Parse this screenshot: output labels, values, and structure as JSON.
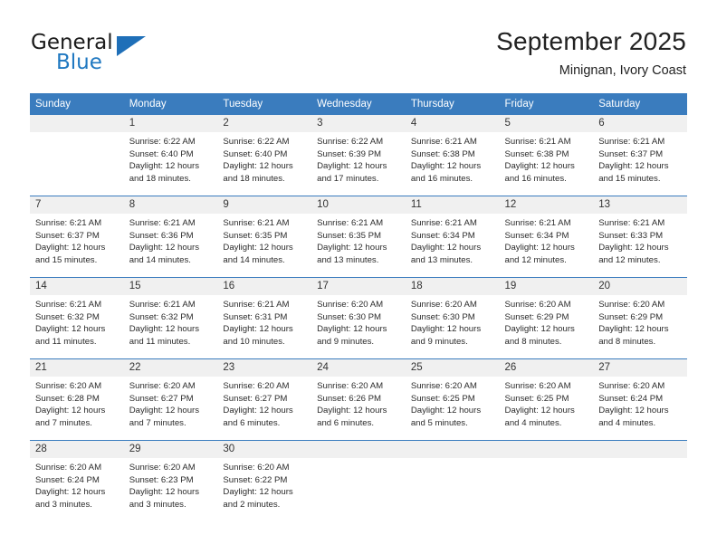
{
  "brand": {
    "line1": "General",
    "line2": "Blue",
    "triangle_color": "#1f6fb8",
    "blue_color": "#1f78c1"
  },
  "header": {
    "month_title": "September 2025",
    "location": "Minignan, Ivory Coast"
  },
  "theme": {
    "header_row_bg": "#3a7cbe",
    "daynum_bg": "#f0f0f0",
    "grid_line": "#3a7cbe"
  },
  "calendar": {
    "weekday_headers": [
      "Sunday",
      "Monday",
      "Tuesday",
      "Wednesday",
      "Thursday",
      "Friday",
      "Saturday"
    ],
    "weeks": [
      [
        {
          "day": "",
          "sunrise": "",
          "sunset": "",
          "daylight_l1": "",
          "daylight_l2": "",
          "empty": true
        },
        {
          "day": "1",
          "sunrise": "Sunrise: 6:22 AM",
          "sunset": "Sunset: 6:40 PM",
          "daylight_l1": "Daylight: 12 hours",
          "daylight_l2": "and 18 minutes."
        },
        {
          "day": "2",
          "sunrise": "Sunrise: 6:22 AM",
          "sunset": "Sunset: 6:40 PM",
          "daylight_l1": "Daylight: 12 hours",
          "daylight_l2": "and 18 minutes."
        },
        {
          "day": "3",
          "sunrise": "Sunrise: 6:22 AM",
          "sunset": "Sunset: 6:39 PM",
          "daylight_l1": "Daylight: 12 hours",
          "daylight_l2": "and 17 minutes."
        },
        {
          "day": "4",
          "sunrise": "Sunrise: 6:21 AM",
          "sunset": "Sunset: 6:38 PM",
          "daylight_l1": "Daylight: 12 hours",
          "daylight_l2": "and 16 minutes."
        },
        {
          "day": "5",
          "sunrise": "Sunrise: 6:21 AM",
          "sunset": "Sunset: 6:38 PM",
          "daylight_l1": "Daylight: 12 hours",
          "daylight_l2": "and 16 minutes."
        },
        {
          "day": "6",
          "sunrise": "Sunrise: 6:21 AM",
          "sunset": "Sunset: 6:37 PM",
          "daylight_l1": "Daylight: 12 hours",
          "daylight_l2": "and 15 minutes."
        }
      ],
      [
        {
          "day": "7",
          "sunrise": "Sunrise: 6:21 AM",
          "sunset": "Sunset: 6:37 PM",
          "daylight_l1": "Daylight: 12 hours",
          "daylight_l2": "and 15 minutes."
        },
        {
          "day": "8",
          "sunrise": "Sunrise: 6:21 AM",
          "sunset": "Sunset: 6:36 PM",
          "daylight_l1": "Daylight: 12 hours",
          "daylight_l2": "and 14 minutes."
        },
        {
          "day": "9",
          "sunrise": "Sunrise: 6:21 AM",
          "sunset": "Sunset: 6:35 PM",
          "daylight_l1": "Daylight: 12 hours",
          "daylight_l2": "and 14 minutes."
        },
        {
          "day": "10",
          "sunrise": "Sunrise: 6:21 AM",
          "sunset": "Sunset: 6:35 PM",
          "daylight_l1": "Daylight: 12 hours",
          "daylight_l2": "and 13 minutes."
        },
        {
          "day": "11",
          "sunrise": "Sunrise: 6:21 AM",
          "sunset": "Sunset: 6:34 PM",
          "daylight_l1": "Daylight: 12 hours",
          "daylight_l2": "and 13 minutes."
        },
        {
          "day": "12",
          "sunrise": "Sunrise: 6:21 AM",
          "sunset": "Sunset: 6:34 PM",
          "daylight_l1": "Daylight: 12 hours",
          "daylight_l2": "and 12 minutes."
        },
        {
          "day": "13",
          "sunrise": "Sunrise: 6:21 AM",
          "sunset": "Sunset: 6:33 PM",
          "daylight_l1": "Daylight: 12 hours",
          "daylight_l2": "and 12 minutes."
        }
      ],
      [
        {
          "day": "14",
          "sunrise": "Sunrise: 6:21 AM",
          "sunset": "Sunset: 6:32 PM",
          "daylight_l1": "Daylight: 12 hours",
          "daylight_l2": "and 11 minutes."
        },
        {
          "day": "15",
          "sunrise": "Sunrise: 6:21 AM",
          "sunset": "Sunset: 6:32 PM",
          "daylight_l1": "Daylight: 12 hours",
          "daylight_l2": "and 11 minutes."
        },
        {
          "day": "16",
          "sunrise": "Sunrise: 6:21 AM",
          "sunset": "Sunset: 6:31 PM",
          "daylight_l1": "Daylight: 12 hours",
          "daylight_l2": "and 10 minutes."
        },
        {
          "day": "17",
          "sunrise": "Sunrise: 6:20 AM",
          "sunset": "Sunset: 6:30 PM",
          "daylight_l1": "Daylight: 12 hours",
          "daylight_l2": "and 9 minutes."
        },
        {
          "day": "18",
          "sunrise": "Sunrise: 6:20 AM",
          "sunset": "Sunset: 6:30 PM",
          "daylight_l1": "Daylight: 12 hours",
          "daylight_l2": "and 9 minutes."
        },
        {
          "day": "19",
          "sunrise": "Sunrise: 6:20 AM",
          "sunset": "Sunset: 6:29 PM",
          "daylight_l1": "Daylight: 12 hours",
          "daylight_l2": "and 8 minutes."
        },
        {
          "day": "20",
          "sunrise": "Sunrise: 6:20 AM",
          "sunset": "Sunset: 6:29 PM",
          "daylight_l1": "Daylight: 12 hours",
          "daylight_l2": "and 8 minutes."
        }
      ],
      [
        {
          "day": "21",
          "sunrise": "Sunrise: 6:20 AM",
          "sunset": "Sunset: 6:28 PM",
          "daylight_l1": "Daylight: 12 hours",
          "daylight_l2": "and 7 minutes."
        },
        {
          "day": "22",
          "sunrise": "Sunrise: 6:20 AM",
          "sunset": "Sunset: 6:27 PM",
          "daylight_l1": "Daylight: 12 hours",
          "daylight_l2": "and 7 minutes."
        },
        {
          "day": "23",
          "sunrise": "Sunrise: 6:20 AM",
          "sunset": "Sunset: 6:27 PM",
          "daylight_l1": "Daylight: 12 hours",
          "daylight_l2": "and 6 minutes."
        },
        {
          "day": "24",
          "sunrise": "Sunrise: 6:20 AM",
          "sunset": "Sunset: 6:26 PM",
          "daylight_l1": "Daylight: 12 hours",
          "daylight_l2": "and 6 minutes."
        },
        {
          "day": "25",
          "sunrise": "Sunrise: 6:20 AM",
          "sunset": "Sunset: 6:25 PM",
          "daylight_l1": "Daylight: 12 hours",
          "daylight_l2": "and 5 minutes."
        },
        {
          "day": "26",
          "sunrise": "Sunrise: 6:20 AM",
          "sunset": "Sunset: 6:25 PM",
          "daylight_l1": "Daylight: 12 hours",
          "daylight_l2": "and 4 minutes."
        },
        {
          "day": "27",
          "sunrise": "Sunrise: 6:20 AM",
          "sunset": "Sunset: 6:24 PM",
          "daylight_l1": "Daylight: 12 hours",
          "daylight_l2": "and 4 minutes."
        }
      ],
      [
        {
          "day": "28",
          "sunrise": "Sunrise: 6:20 AM",
          "sunset": "Sunset: 6:24 PM",
          "daylight_l1": "Daylight: 12 hours",
          "daylight_l2": "and 3 minutes."
        },
        {
          "day": "29",
          "sunrise": "Sunrise: 6:20 AM",
          "sunset": "Sunset: 6:23 PM",
          "daylight_l1": "Daylight: 12 hours",
          "daylight_l2": "and 3 minutes."
        },
        {
          "day": "30",
          "sunrise": "Sunrise: 6:20 AM",
          "sunset": "Sunset: 6:22 PM",
          "daylight_l1": "Daylight: 12 hours",
          "daylight_l2": "and 2 minutes."
        },
        {
          "day": "",
          "sunrise": "",
          "sunset": "",
          "daylight_l1": "",
          "daylight_l2": "",
          "empty": true
        },
        {
          "day": "",
          "sunrise": "",
          "sunset": "",
          "daylight_l1": "",
          "daylight_l2": "",
          "empty": true
        },
        {
          "day": "",
          "sunrise": "",
          "sunset": "",
          "daylight_l1": "",
          "daylight_l2": "",
          "empty": true
        },
        {
          "day": "",
          "sunrise": "",
          "sunset": "",
          "daylight_l1": "",
          "daylight_l2": "",
          "empty": true
        }
      ]
    ]
  }
}
